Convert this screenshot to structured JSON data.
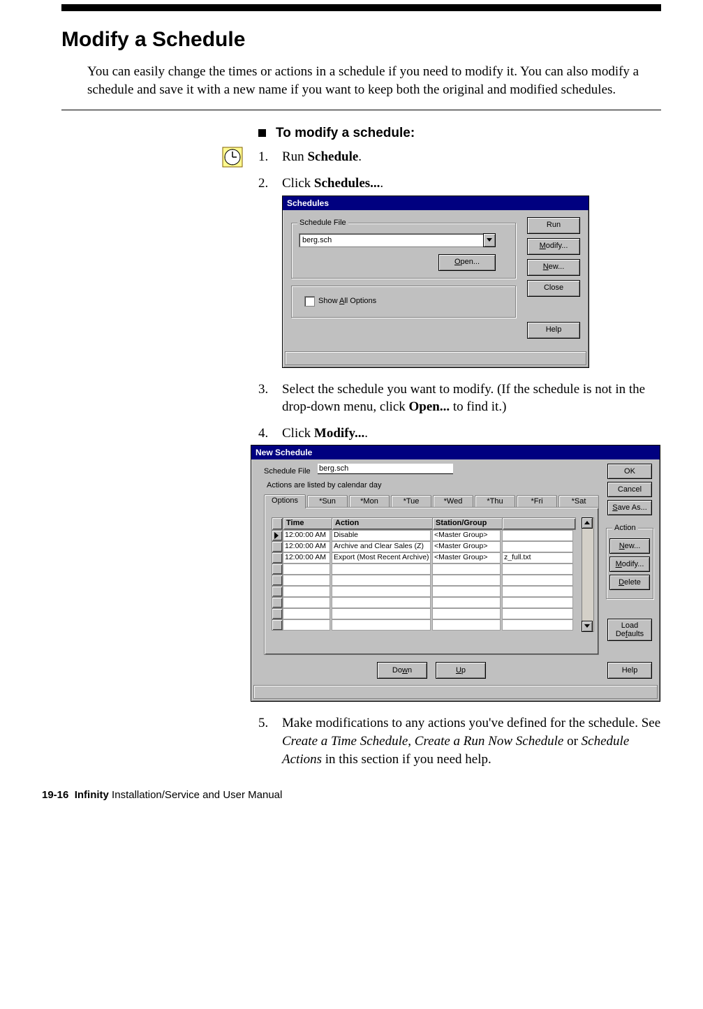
{
  "page": {
    "section_title": "Modify a Schedule",
    "intro": "You can easily change the times or actions in a schedule if you need to modify it. You can also modify a schedule and save it with a new name if you want to keep both the original and modified schedules.",
    "task_title": "To modify a schedule:",
    "steps": {
      "s1_pre": "Run ",
      "s1_b": "Schedule",
      "s1_post": ".",
      "s2_pre": "Click ",
      "s2_b": "Schedules...",
      "s2_post": ".",
      "s3_pre": "Select the schedule you want to modify. (If the schedule is not in the drop-down menu, click ",
      "s3_b": "Open...",
      "s3_post": " to find it.)",
      "s4_pre": "Click ",
      "s4_b": "Modify...",
      "s4_post": ".",
      "s5_pre": "Make modifications to any actions you've defined for the schedule. See ",
      "s5_i1": "Create a Time Schedule",
      "s5_mid1": ", ",
      "s5_i2": "Create a Run Now Schedule",
      "s5_mid2": " or ",
      "s5_i3": "Schedule Actions",
      "s5_post": " in this section if you need help."
    },
    "footer_page": "19-16",
    "footer_bold": "Infinity",
    "footer_rest": " Installation/Service and User Manual"
  },
  "dlg1": {
    "title": "Schedules",
    "group_label": "Schedule File",
    "file_value": "berg.sch",
    "open_u": "O",
    "open_rest": "pen...",
    "showall_pre": "Show ",
    "showall_u": "A",
    "showall_post": "ll Options",
    "btn_run": "Run",
    "btn_modify_u": "M",
    "btn_modify_rest": "odify...",
    "btn_new_u": "N",
    "btn_new_rest": "ew...",
    "btn_close": "Close",
    "btn_help": "Help"
  },
  "dlg2": {
    "title": "New Schedule",
    "file_label": "Schedule File",
    "file_value": "berg.sch",
    "note": "Actions are listed by calendar day",
    "tabs": [
      "Options",
      "*Sun",
      "*Mon",
      "*Tue",
      "*Wed",
      "*Thu",
      "*Fri",
      "*Sat"
    ],
    "col_time": "Time",
    "col_action": "Action",
    "col_station": "Station/Group",
    "rows": [
      {
        "time": "12:00:00 AM",
        "action": "Disable",
        "station": "<Master Group>",
        "extra": ""
      },
      {
        "time": "12:00:00 AM",
        "action": "Archive and Clear Sales (Z)",
        "station": "<Master Group>",
        "extra": ""
      },
      {
        "time": "12:00:00 AM",
        "action": "Export (Most Recent Archive)",
        "station": "<Master Group>",
        "extra": "z_full.txt"
      }
    ],
    "btn_down_pre": "Do",
    "btn_down_u": "w",
    "btn_down_post": "n",
    "btn_up_u": "U",
    "btn_up_post": "p",
    "btn_ok": "OK",
    "btn_cancel": "Cancel",
    "btn_saveas_u": "S",
    "btn_saveas_rest": "ave As...",
    "group_action": "Action",
    "btn_new_u": "N",
    "btn_new_rest": "ew...",
    "btn_modify_u": "M",
    "btn_modify_rest": "odify...",
    "btn_delete_u": "D",
    "btn_delete_rest": "elete",
    "btn_load_pre": "Load\nDe",
    "btn_load_u": "f",
    "btn_load_post": "aults",
    "btn_help": "Help"
  }
}
